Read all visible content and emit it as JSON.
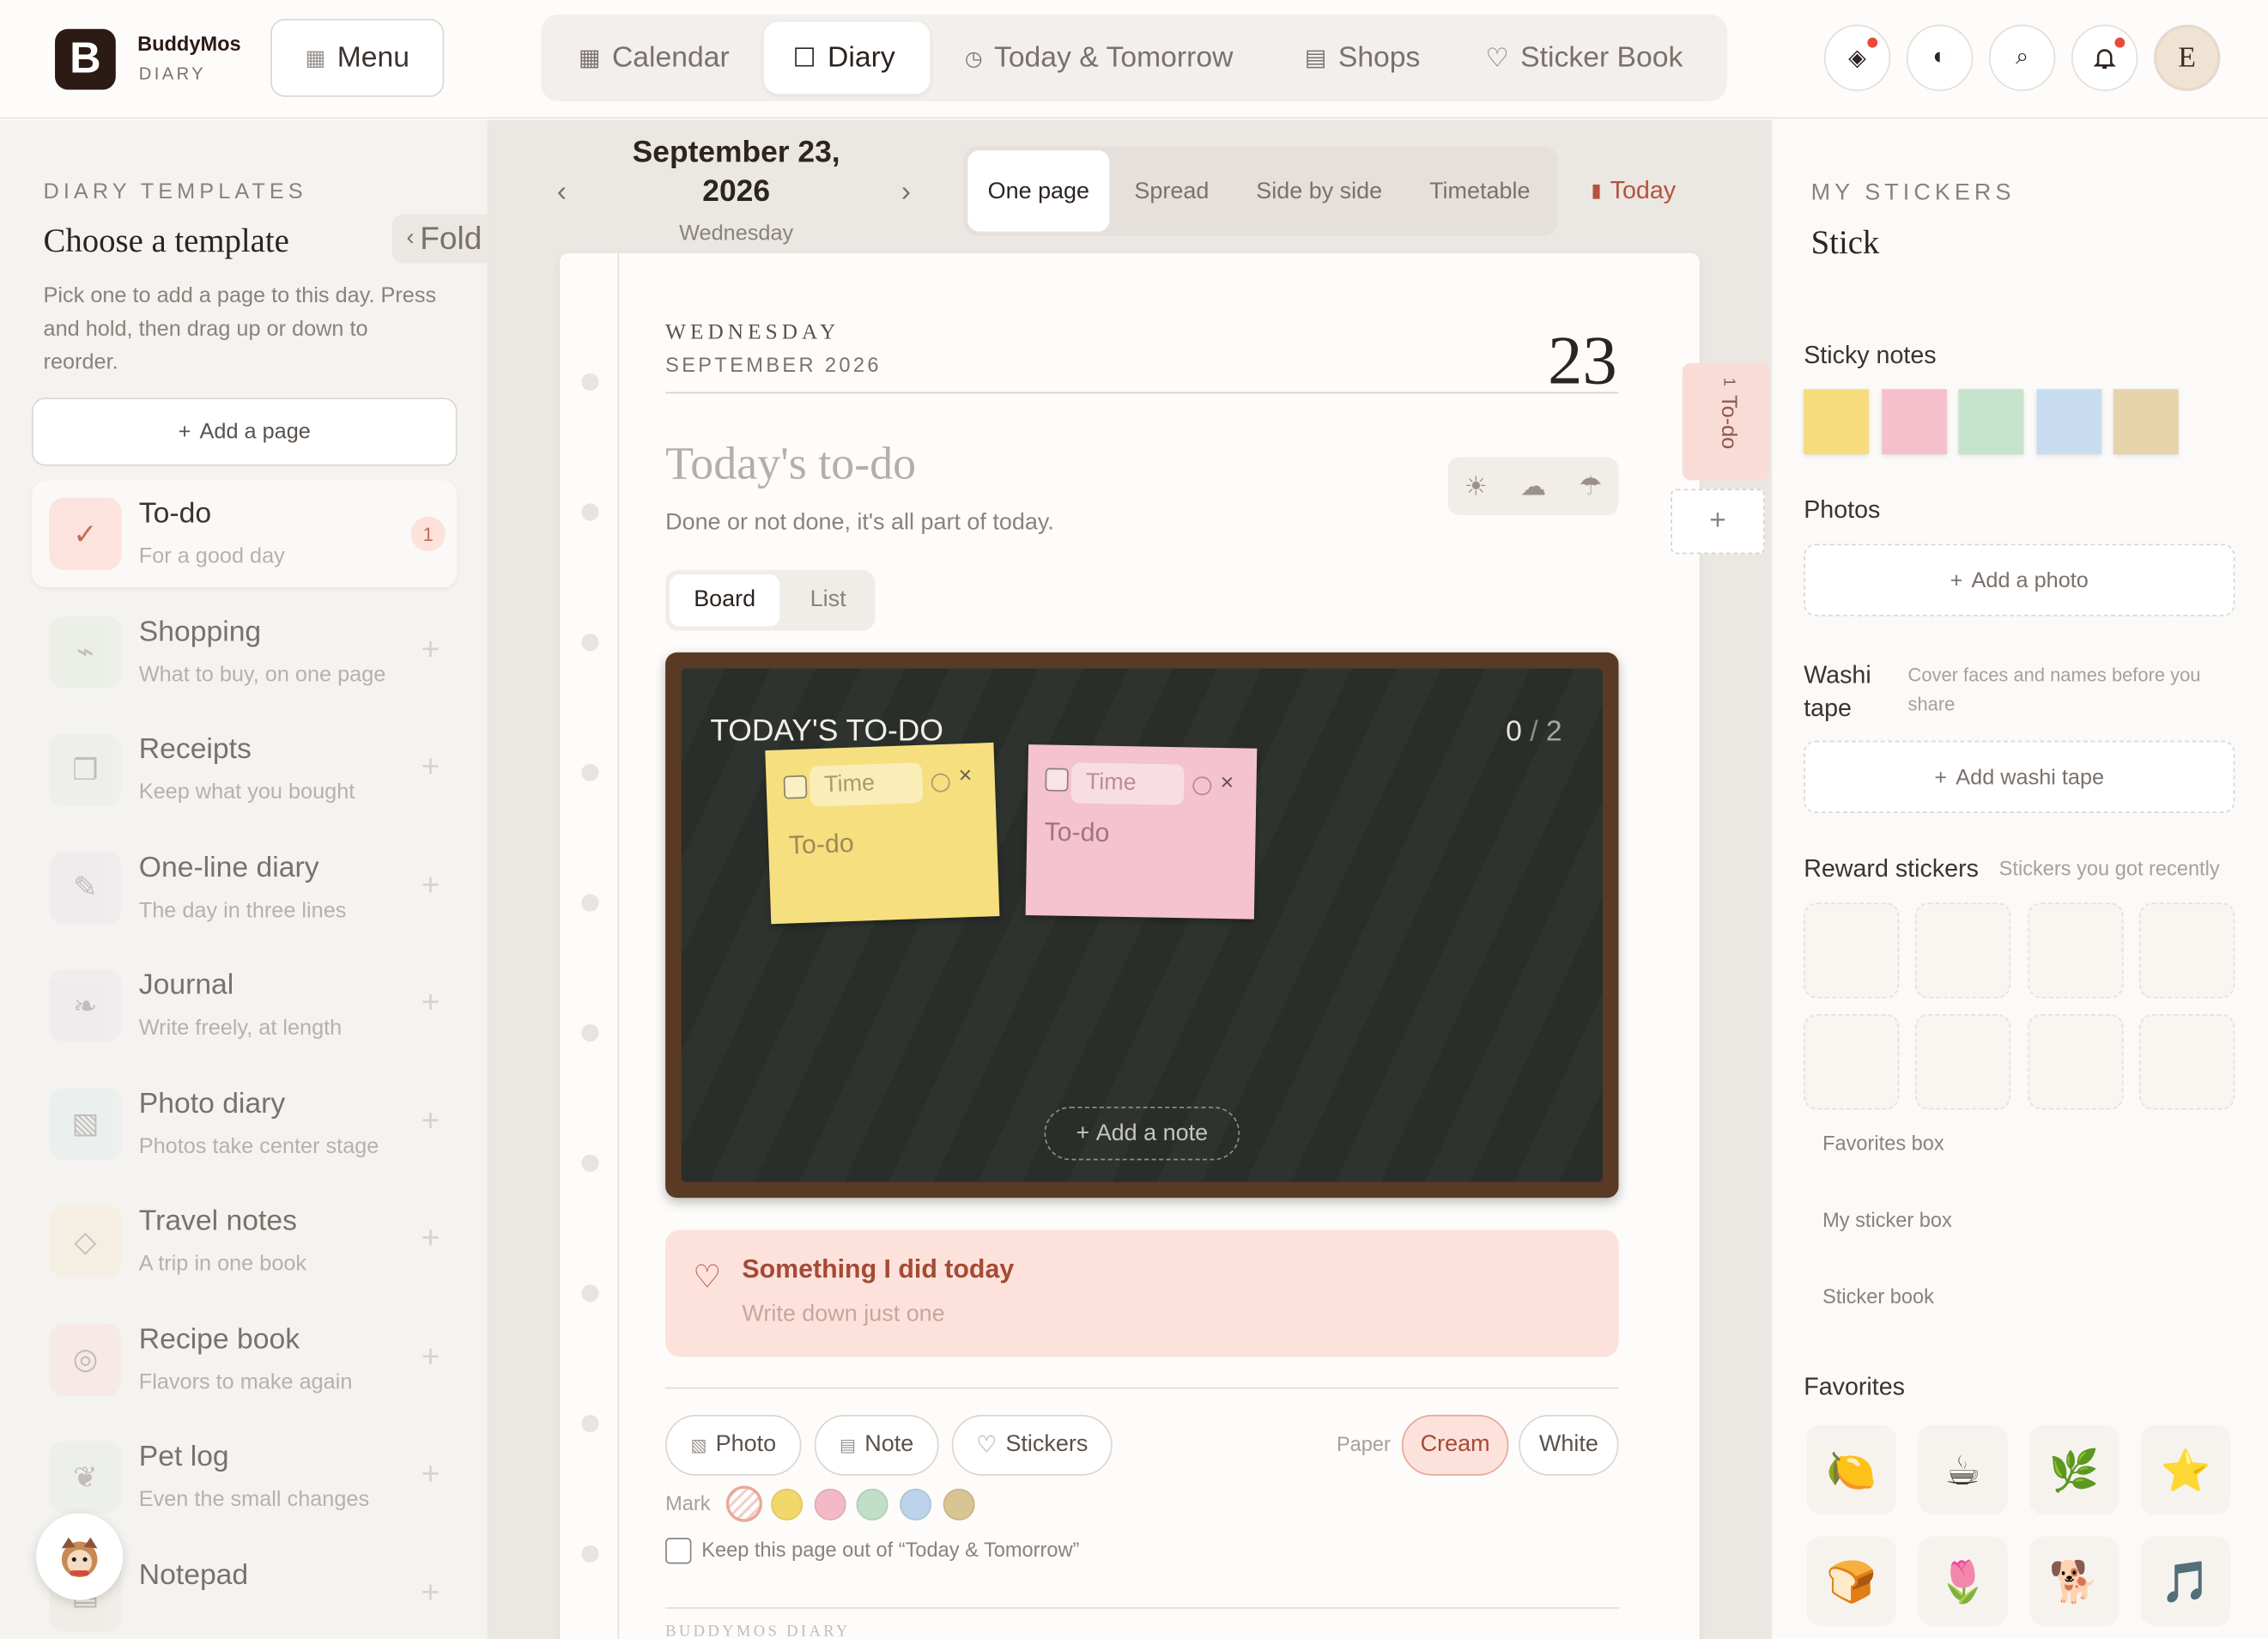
{
  "app": {
    "name": "BuddyMos",
    "sub": "DIARY",
    "logo_letter": "B"
  },
  "header": {
    "menu_label": "Menu",
    "nav": [
      {
        "label": "Calendar",
        "icon": "calendar-icon"
      },
      {
        "label": "Diary",
        "icon": "square-icon",
        "active": true
      },
      {
        "label": "Today & Tomorrow",
        "icon": "clock-icon"
      },
      {
        "label": "Shops",
        "icon": "shop-icon"
      },
      {
        "label": "Sticker Book",
        "icon": "heart-icon"
      }
    ],
    "avatar_initial": "E"
  },
  "left": {
    "caps": "DIARY TEMPLATES",
    "title": "Choose a template",
    "fold_label": "Fold",
    "description": "Pick one to add a page to this day. Press and hold, then drag up or down to reorder.",
    "add_page": "Add a page",
    "templates": [
      {
        "title": "To-do",
        "subtitle": "For a good day",
        "badge": "1",
        "icon": "check-icon",
        "color": "#fce3dd"
      },
      {
        "title": "Shopping",
        "subtitle": "What to buy, on one page",
        "icon": "tag-icon",
        "color": "#e3ece3"
      },
      {
        "title": "Receipts",
        "subtitle": "Keep what you bought",
        "icon": "receipt-icon",
        "color": "#e9ece9"
      },
      {
        "title": "One-line diary",
        "subtitle": "The day in three lines",
        "icon": "pencil-icon",
        "color": "#ebe8ee"
      },
      {
        "title": "Journal",
        "subtitle": "Write freely, at length",
        "icon": "feather-icon",
        "color": "#ebe8ee"
      },
      {
        "title": "Photo diary",
        "subtitle": "Photos take center stage",
        "icon": "photo-icon",
        "color": "#e4ecee"
      },
      {
        "title": "Travel notes",
        "subtitle": "A trip in one book",
        "icon": "diamond-icon",
        "color": "#f4ecd8"
      },
      {
        "title": "Recipe book",
        "subtitle": "Flavors to make again",
        "icon": "circle-icon",
        "color": "#f8e1df"
      },
      {
        "title": "Pet log",
        "subtitle": "Even the small changes",
        "icon": "paw-icon",
        "color": "#e6ece6"
      },
      {
        "title": "Notepad",
        "subtitle": "",
        "icon": "note-icon",
        "color": "#ece8e2"
      }
    ]
  },
  "center": {
    "date_line1": "September 23,",
    "date_line2": "2026",
    "weekday": "Wednesday",
    "views": [
      "One page",
      "Spread",
      "Side by side",
      "Timetable"
    ],
    "active_view": "One page",
    "today_label": "Today",
    "page": {
      "day_caps": "WEDNESDAY",
      "month_caps": "SEPTEMBER 2026",
      "day_number": "23",
      "title": "Today's to-do",
      "subtitle": "Done or not done, it's all part of today.",
      "tabs": [
        "Board",
        "List"
      ],
      "active_tab": "Board",
      "board_title": "TODAY'S TO-DO",
      "board_count_done": "0",
      "board_count_total": "2",
      "notes": [
        {
          "time_placeholder": "Time",
          "text": "To-do",
          "color": "#f6df7e"
        },
        {
          "time_placeholder": "Time",
          "text": "To-do",
          "color": "#f5c2cf"
        }
      ],
      "add_note": "Add a note",
      "did_title": "Something I did today",
      "did_placeholder": "Write down just one",
      "chips": [
        "Photo",
        "Note",
        "Stickers"
      ],
      "paper_label": "Paper",
      "paper_options": [
        "Cream",
        "White"
      ],
      "paper_selected": "Cream",
      "mark_label": "Mark",
      "mark_colors": [
        "#f2d86a",
        "#f4b9c6",
        "#bfdfc6",
        "#bcd3ea",
        "#d9c493"
      ],
      "keep_out_label": "Keep this page out of “Today & Tomorrow”",
      "footer_left": "BUDDYMOS DIARY"
    },
    "side_tab": {
      "number": "1",
      "label": "To-do"
    }
  },
  "right": {
    "caps": "MY STICKERS",
    "title": "Stick",
    "sticky_notes_label": "Sticky notes",
    "sticky_colors": [
      "#f6dc7c",
      "#f5c0cc",
      "#c6e3cc",
      "#c8dcef",
      "#e6d3aa"
    ],
    "photos_label": "Photos",
    "add_photo": "Add a photo",
    "washi_label": "Washi tape",
    "washi_hint": "Cover faces and names before you share",
    "add_washi": "Add washi tape",
    "reward_label": "Reward stickers",
    "reward_hint": "Stickers you got recently",
    "links": [
      "Favorites box",
      "My sticker box",
      "Sticker book"
    ],
    "favorites_label": "Favorites",
    "favorites": [
      "🍋",
      "☕",
      "🌿",
      "⭐",
      "🍞",
      "🌷",
      "🐕",
      "🎵"
    ]
  }
}
